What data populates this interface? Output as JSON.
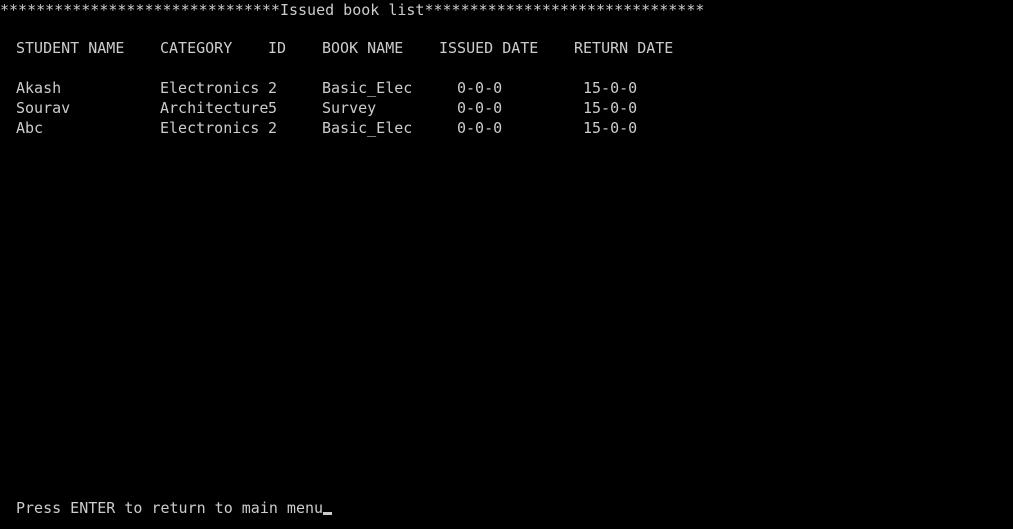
{
  "banner": "*******************************Issued book list*******************************",
  "headers": {
    "student_name": "STUDENT NAME",
    "category": "CATEGORY",
    "id": "ID",
    "book_name": "BOOK NAME",
    "issued_date": "ISSUED DATE",
    "return_date": "RETURN DATE"
  },
  "rows": [
    {
      "student_name": "Akash",
      "category": "Electronics",
      "id": "2",
      "book_name": "Basic_Elec",
      "issued_date": "0-0-0",
      "return_date": "15-0-0"
    },
    {
      "student_name": "Sourav",
      "category": "Architecture",
      "id": "5",
      "book_name": "Survey",
      "issued_date": "0-0-0",
      "return_date": "15-0-0"
    },
    {
      "student_name": "Abc",
      "category": "Electronics",
      "id": "2",
      "book_name": "Basic_Elec",
      "issued_date": "0-0-0",
      "return_date": "15-0-0"
    }
  ],
  "prompt": "Press ENTER to return to main menu",
  "colors": {
    "background": "#000000",
    "text": "#cccccc"
  }
}
